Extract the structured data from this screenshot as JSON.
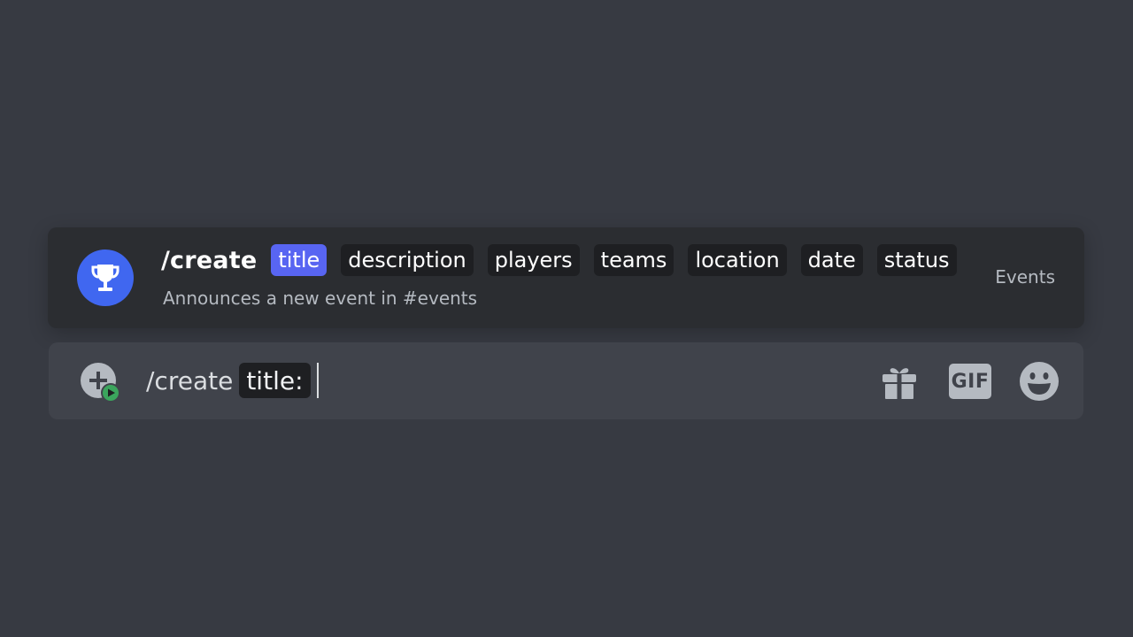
{
  "suggestion": {
    "command": "/create",
    "options": [
      {
        "label": "title",
        "active": true
      },
      {
        "label": "description",
        "active": false
      },
      {
        "label": "players",
        "active": false
      },
      {
        "label": "teams",
        "active": false
      },
      {
        "label": "location",
        "active": false
      },
      {
        "label": "date",
        "active": false
      },
      {
        "label": "status",
        "active": false
      }
    ],
    "description": "Announces a new event in #events",
    "app_name": "Events",
    "avatar_icon": "trophy-icon",
    "avatar_color": "#4067f0",
    "active_chip_color": "#5865f2"
  },
  "composer": {
    "typed_command": "/create",
    "active_option": "title:",
    "attach_icon": "add-circle-icon",
    "activity_icon": "play-icon",
    "gift_icon": "gift-icon",
    "gif_label": "GIF",
    "emoji_icon": "smile-emoji-icon"
  },
  "colors": {
    "background": "#373a42",
    "card": "#2b2d31",
    "composer": "#40434b",
    "chip": "#1e1f22",
    "status_green": "#3ba55d"
  }
}
